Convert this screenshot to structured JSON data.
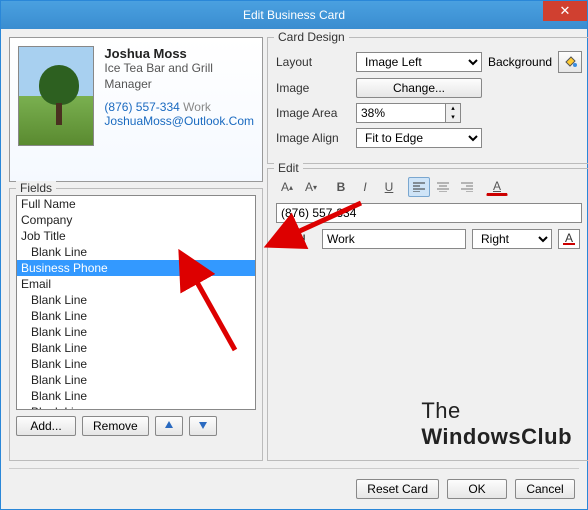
{
  "window": {
    "title": "Edit Business Card"
  },
  "card": {
    "name": "Joshua Moss",
    "company": "Ice Tea Bar and Grill",
    "job_title": "Manager",
    "phone": "(876) 557-334",
    "phone_label": "Work",
    "email": "JoshuaMoss@Outlook.Com"
  },
  "design": {
    "legend": "Card Design",
    "layout_label": "Layout",
    "layout_value": "Image Left",
    "background_label": "Background",
    "image_label": "Image",
    "change_btn": "Change...",
    "image_area_label": "Image Area",
    "image_area_value": "38%",
    "image_align_label": "Image Align",
    "image_align_value": "Fit to Edge"
  },
  "fields": {
    "legend": "Fields",
    "items": [
      {
        "label": "Full Name",
        "indent": false,
        "selected": false
      },
      {
        "label": "Company",
        "indent": false,
        "selected": false
      },
      {
        "label": "Job Title",
        "indent": false,
        "selected": false
      },
      {
        "label": "Blank Line",
        "indent": true,
        "selected": false
      },
      {
        "label": "Business Phone",
        "indent": false,
        "selected": true
      },
      {
        "label": "Email",
        "indent": false,
        "selected": false
      },
      {
        "label": "Blank Line",
        "indent": true,
        "selected": false
      },
      {
        "label": "Blank Line",
        "indent": true,
        "selected": false
      },
      {
        "label": "Blank Line",
        "indent": true,
        "selected": false
      },
      {
        "label": "Blank Line",
        "indent": true,
        "selected": false
      },
      {
        "label": "Blank Line",
        "indent": true,
        "selected": false
      },
      {
        "label": "Blank Line",
        "indent": true,
        "selected": false
      },
      {
        "label": "Blank Line",
        "indent": true,
        "selected": false
      },
      {
        "label": "Blank Line",
        "indent": true,
        "selected": false
      }
    ],
    "add_btn": "Add...",
    "remove_btn": "Remove"
  },
  "edit": {
    "legend": "Edit",
    "value": "(876) 557-334",
    "label_label": "Label",
    "label_value": "Work",
    "align_value": "Right"
  },
  "footer": {
    "reset": "Reset Card",
    "ok": "OK",
    "cancel": "Cancel"
  },
  "logo": {
    "line1": "The",
    "line2": "WindowsClub"
  }
}
